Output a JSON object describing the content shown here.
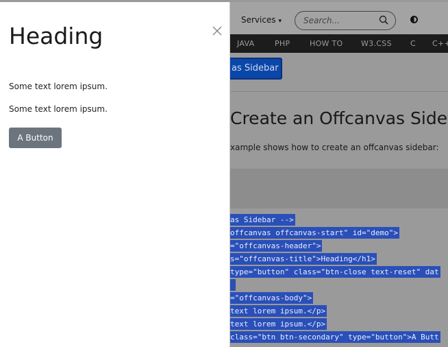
{
  "background": {
    "topbar": {
      "services_label": "Services",
      "services_caret": "▾",
      "search_placeholder": "Search..."
    },
    "nav_items": [
      "JAVA",
      "PHP",
      "HOW TO",
      "W3.CSS",
      "C",
      "C++"
    ],
    "sidebar_button_label": "as Sidebar",
    "heading": "Create an Offcanvas Sidebar",
    "description": "xample shows how to create an offcanvas sidebar:",
    "code_lines": [
      "as Sidebar -->",
      "offcanvas offcanvas-start\" id=\"demo\">",
      "=\"offcanvas-header\">",
      "s=\"offcanvas-title\">Heading</h1>",
      "type=\"button\" class=\"btn-close text-reset\" dat",
      "",
      "=\"offcanvas-body\">",
      "text lorem ipsum.</p>",
      "text lorem ipsum.</p>",
      "class=\"btn btn-secondary\" type=\"button\">A Butt"
    ]
  },
  "offcanvas": {
    "title": "Heading",
    "text1": "Some text lorem ipsum.",
    "text2": "Some text lorem ipsum.",
    "button_label": "A Button"
  },
  "colors": {
    "code_highlight": "#2a4fb8",
    "nav_bg": "#1c1c1c",
    "secondary_button": "#6c757d"
  }
}
